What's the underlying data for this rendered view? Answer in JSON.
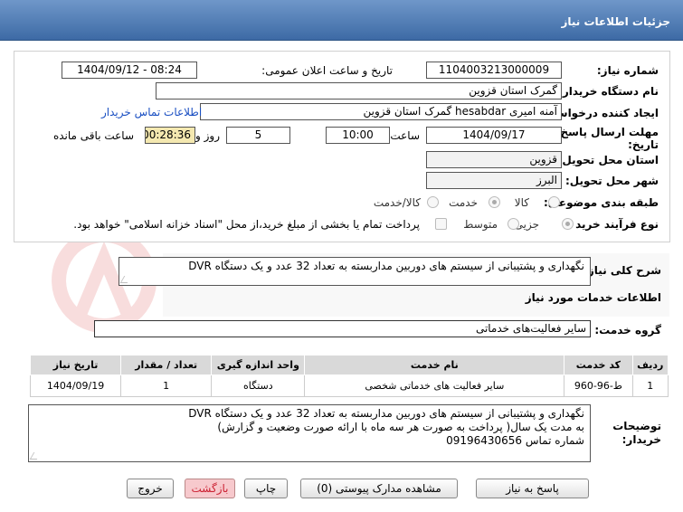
{
  "header": {
    "title": "جزئیات اطلاعات نیاز"
  },
  "form": {
    "need_number_label": "شماره نیاز:",
    "need_number": "1104003213000009",
    "announce_label": "تاریخ و ساعت اعلان عمومی:",
    "announce_value": "1404/09/12 - 08:24",
    "buyer_org_label": "نام دستگاه خریدار:",
    "buyer_org": "گمرک استان قزوین",
    "creator_label": "ایجاد کننده درخواست:",
    "creator": "آمنه امیری hesabdar گمرک استان قزوین",
    "contact_link": "اطلاعات تماس خریدار",
    "deadline_label_1": "مهلت ارسال پاسخ: تا",
    "deadline_label_2": "تاریخ:",
    "deadline_date": "1404/09/17",
    "time_label": "ساعت",
    "deadline_time": "10:00",
    "days_value": "5",
    "days_label": "روز و",
    "remaining_value": "00:28:36",
    "remaining_label": "ساعت باقی مانده",
    "province_label": "استان محل تحویل:",
    "province": "قزوین",
    "city_label": "شهر محل تحویل:",
    "city": "البرز",
    "category_label": "طبقه بندی موضوعی:",
    "category_options": [
      "کالا",
      "خدمت",
      "کالا/خدمت"
    ],
    "category_selected": "خدمت",
    "process_label": "نوع فرآیند خرید :",
    "process_options": [
      "جزیی",
      "متوسط"
    ],
    "process_selected": "جزیی",
    "payment_text": "پرداخت تمام یا بخشی از مبلغ خرید،از محل \"اسناد خزانه اسلامی\" خواهد بود."
  },
  "summary": {
    "label": "شرح کلی نیاز:",
    "text": "نگهداری و پشتیبانی از سیستم های دوربین مداربسته به تعداد 32 عدد و یک دستگاه DVR"
  },
  "services": {
    "section_title": "اطلاعات خدمات مورد نیاز",
    "group_label": "گروه خدمت:",
    "group_value": "سایر فعالیت‌های خدماتی",
    "columns": [
      "ردیف",
      "کد خدمت",
      "نام خدمت",
      "واحد اندازه گیری",
      "تعداد / مقدار",
      "تاریخ نیاز"
    ],
    "rows": [
      [
        "1",
        "ط-96-960",
        "سایر فعالیت های خدماتی شخصی",
        "دستگاه",
        "1",
        "1404/09/19"
      ]
    ]
  },
  "buyer_notes": {
    "label_1": "توضیحات",
    "label_2": "خریدار:",
    "line_1": "نگهداری و پشتیبانی از سیستم های دوربین مداربسته به تعداد 32 عدد و یک دستگاه DVR",
    "line_2": "به مدت یک سال( پرداخت به صورت هر سه ماه با ارائه صورت وضعیت و گزارش)",
    "line_3": "شماره تماس 09196430656"
  },
  "buttons": {
    "respond": "پاسخ به نیاز",
    "attachments": "مشاهده مدارک پیوستی (0)",
    "print": "چاپ",
    "back": "بازگشت",
    "exit": "خروج"
  },
  "colors": {
    "header_top": "#6f97c9",
    "header_bottom": "#3d6aa5",
    "remaining_bg": "#f4e8b0",
    "link": "#1a4fc2",
    "table_header_bg": "#d9d9d9"
  }
}
